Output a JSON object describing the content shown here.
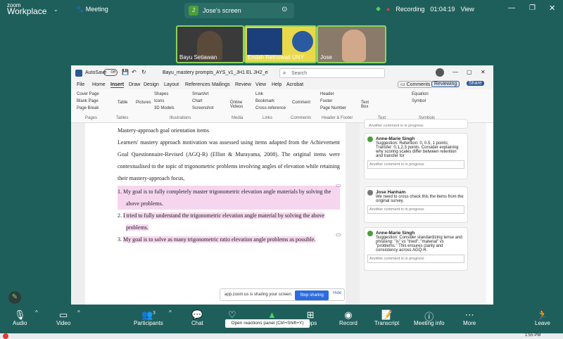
{
  "zoom": {
    "logo_top": "zoom",
    "logo_bottom": "Workplace",
    "meeting_label": "Meeting",
    "share_pill_initial": "J",
    "share_pill_label": "Jose's screen",
    "recording_label": "Recording",
    "timer": "01:04:19",
    "view_label": "View"
  },
  "participants_video": [
    {
      "name": "Bayu Setiawan"
    },
    {
      "name": "Endah Retnowati UNY"
    },
    {
      "name": "Jose"
    }
  ],
  "word": {
    "autosave": "AutoSave",
    "autosave_state": "Off",
    "file_name": "Bayu_mastery prompts_AYS_v1_JH1 EL JH2_eb14_...",
    "search_placeholder": "Search",
    "menu": [
      "File",
      "Home",
      "Insert",
      "Draw",
      "Design",
      "Layout",
      "References",
      "Mailings",
      "Review",
      "View",
      "Help",
      "Acrobat"
    ],
    "comments_btn": "Comments",
    "reviewing_btn": "Reviewing",
    "share_btn": "Share",
    "ribbon": {
      "pages": [
        "Cover Page",
        "Blank Page",
        "Page Break"
      ],
      "pages_label": "Pages",
      "table": "Table",
      "tables_label": "Tables",
      "pictures": "Pictures",
      "shapes": "Shapes",
      "icons": "Icons",
      "models": "3D Models",
      "smartart": "SmartArt",
      "chart": "Chart",
      "screenshot": "Screenshot",
      "illustrations_label": "Illustrations",
      "online_videos": "Online Videos",
      "media_label": "Media",
      "link": "Link",
      "bookmark": "Bookmark",
      "crossref": "Cross-reference",
      "links_label": "Links",
      "comment": "Comment",
      "comments_label": "Comments",
      "header": "Header",
      "footer": "Footer",
      "page_number": "Page Number",
      "hf_label": "Header & Footer",
      "text_box": "Text Box",
      "text_label": "Text",
      "equation": "Equation",
      "symbol": "Symbol",
      "symbols_label": "Symbols"
    },
    "doc": {
      "heading": "Mastery-approach goal orientation items",
      "para1": "Learners' mastery approach motivation was assessed using items adapted from the Achievement Goal Questionnaire-Revised (AGQ-R) (Elliot & Murayama, 2008). The original items were contextualised to the topic of trigonometric problems involving angles of elevation while retaining their mastery-approach focus,",
      "items": [
        {
          "num": "1.",
          "text": "My goal is to fully completely master trigonometric elevation angle materials by solving the above problems."
        },
        {
          "num": "2.",
          "text": "I tried to fully understand the trigonometric elevation angle material by solving the above problems."
        },
        {
          "num": "3.",
          "text": "My goal is to solve as many trigonometric ratio elevation angle problems as possible."
        }
      ]
    },
    "comments": [
      {
        "author": "",
        "text": "Another comment is in progress",
        "reply": ""
      },
      {
        "author": "Anne-Marie Singh",
        "text": "Suggestion: Retention: 0, 0.5, 1 points; Transfer: 0,1,2,3 points. Consider explaining why scoring scales differ between retention and transfer for",
        "reply": "Another comment is in progress"
      },
      {
        "author": "Jose Hanham",
        "text": "We need to cross check this the items from the original survey.",
        "reply": "Another comment is in progress"
      },
      {
        "author": "Anne-Marie Singh",
        "text": "Suggestion: Consider standardizing tense and phrasing: \"is\" vs \"tried\"; \"material\" vs \"problems.\" This ensures clarity and consistency across AGQ-R.",
        "reply": "Another comment is in progress"
      }
    ]
  },
  "share_banner": {
    "text": "app.zoom.us is sharing your screen.",
    "stop": "Stop sharing",
    "hide": "Hide"
  },
  "toolbar": {
    "audio": "Audio",
    "video": "Video",
    "participants": "Participants",
    "participants_count": "3",
    "chat": "Chat",
    "apps": "Apps",
    "record": "Record",
    "transcript": "Transcript",
    "meeting_info": "Meeting info",
    "more": "More",
    "leave": "Leave",
    "tooltip": "Open reactions panel (Ctrl+Shift+Y)"
  },
  "taskbar": {
    "time": "1:55 PM"
  },
  "colors": {
    "zoom_bg": "#1f5f5b",
    "accent_green": "#8bd35a",
    "word_blue": "#2d6cdf",
    "comment_highlight": "#f6d6ef"
  }
}
